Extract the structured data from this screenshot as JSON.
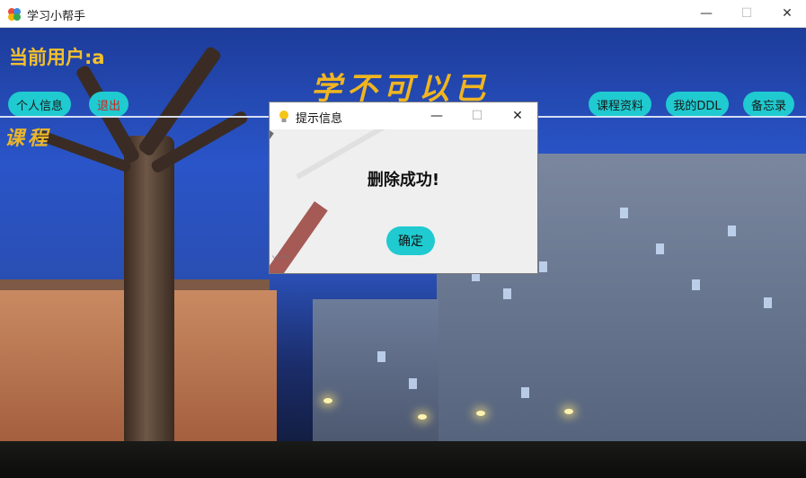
{
  "window": {
    "title": "学习小帮手",
    "minimize_glyph": "—",
    "maximize_glyph": "☐",
    "close_glyph": "✕"
  },
  "header": {
    "current_user": "当前用户:a",
    "motto": "学不可以已"
  },
  "nav_left": [
    {
      "label": "个人信息"
    },
    {
      "label": "退出"
    }
  ],
  "nav_right": [
    {
      "label": "课程资料"
    },
    {
      "label": "我的DDL"
    },
    {
      "label": "备忘录"
    }
  ],
  "section": {
    "label": "课程"
  },
  "dialog": {
    "title": "提示信息",
    "message": "删除成功!",
    "ok_label": "确定",
    "minimize_glyph": "—",
    "maximize_glyph": "☐",
    "close_glyph": "✕"
  },
  "colors": {
    "accent_button": "#1fcad0",
    "title_yellow": "#f2c02c",
    "logout_red": "#d0241c"
  }
}
